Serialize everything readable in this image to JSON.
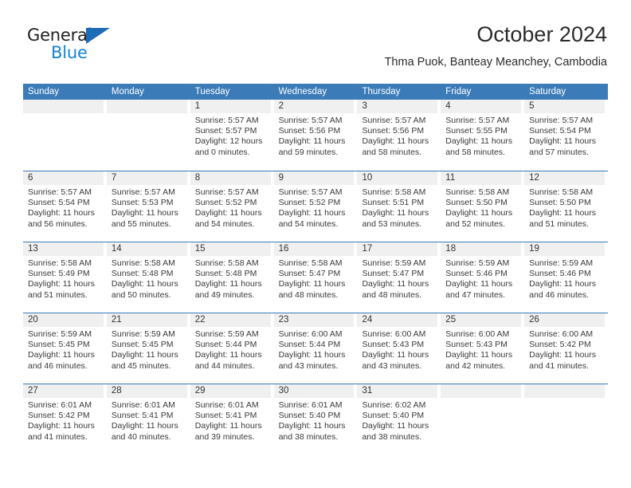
{
  "brand": {
    "name_top": "General",
    "name_bottom": "Blue",
    "triangle_color": "#1e6cb5",
    "blue_color": "#1583d4"
  },
  "header": {
    "month_title": "October 2024",
    "location": "Thma Puok, Banteay Meanchey, Cambodia",
    "header_bg": "#3b7cb8",
    "daynum_bg": "#f0f0f0"
  },
  "weekdays": [
    "Sunday",
    "Monday",
    "Tuesday",
    "Wednesday",
    "Thursday",
    "Friday",
    "Saturday"
  ],
  "weeks": [
    [
      {
        "day": ""
      },
      {
        "day": ""
      },
      {
        "day": "1",
        "sunrise": "Sunrise: 5:57 AM",
        "sunset": "Sunset: 5:57 PM",
        "daylight1": "Daylight: 12 hours",
        "daylight2": "and 0 minutes."
      },
      {
        "day": "2",
        "sunrise": "Sunrise: 5:57 AM",
        "sunset": "Sunset: 5:56 PM",
        "daylight1": "Daylight: 11 hours",
        "daylight2": "and 59 minutes."
      },
      {
        "day": "3",
        "sunrise": "Sunrise: 5:57 AM",
        "sunset": "Sunset: 5:56 PM",
        "daylight1": "Daylight: 11 hours",
        "daylight2": "and 58 minutes."
      },
      {
        "day": "4",
        "sunrise": "Sunrise: 5:57 AM",
        "sunset": "Sunset: 5:55 PM",
        "daylight1": "Daylight: 11 hours",
        "daylight2": "and 58 minutes."
      },
      {
        "day": "5",
        "sunrise": "Sunrise: 5:57 AM",
        "sunset": "Sunset: 5:54 PM",
        "daylight1": "Daylight: 11 hours",
        "daylight2": "and 57 minutes."
      }
    ],
    [
      {
        "day": "6",
        "sunrise": "Sunrise: 5:57 AM",
        "sunset": "Sunset: 5:54 PM",
        "daylight1": "Daylight: 11 hours",
        "daylight2": "and 56 minutes."
      },
      {
        "day": "7",
        "sunrise": "Sunrise: 5:57 AM",
        "sunset": "Sunset: 5:53 PM",
        "daylight1": "Daylight: 11 hours",
        "daylight2": "and 55 minutes."
      },
      {
        "day": "8",
        "sunrise": "Sunrise: 5:57 AM",
        "sunset": "Sunset: 5:52 PM",
        "daylight1": "Daylight: 11 hours",
        "daylight2": "and 54 minutes."
      },
      {
        "day": "9",
        "sunrise": "Sunrise: 5:57 AM",
        "sunset": "Sunset: 5:52 PM",
        "daylight1": "Daylight: 11 hours",
        "daylight2": "and 54 minutes."
      },
      {
        "day": "10",
        "sunrise": "Sunrise: 5:58 AM",
        "sunset": "Sunset: 5:51 PM",
        "daylight1": "Daylight: 11 hours",
        "daylight2": "and 53 minutes."
      },
      {
        "day": "11",
        "sunrise": "Sunrise: 5:58 AM",
        "sunset": "Sunset: 5:50 PM",
        "daylight1": "Daylight: 11 hours",
        "daylight2": "and 52 minutes."
      },
      {
        "day": "12",
        "sunrise": "Sunrise: 5:58 AM",
        "sunset": "Sunset: 5:50 PM",
        "daylight1": "Daylight: 11 hours",
        "daylight2": "and 51 minutes."
      }
    ],
    [
      {
        "day": "13",
        "sunrise": "Sunrise: 5:58 AM",
        "sunset": "Sunset: 5:49 PM",
        "daylight1": "Daylight: 11 hours",
        "daylight2": "and 51 minutes."
      },
      {
        "day": "14",
        "sunrise": "Sunrise: 5:58 AM",
        "sunset": "Sunset: 5:48 PM",
        "daylight1": "Daylight: 11 hours",
        "daylight2": "and 50 minutes."
      },
      {
        "day": "15",
        "sunrise": "Sunrise: 5:58 AM",
        "sunset": "Sunset: 5:48 PM",
        "daylight1": "Daylight: 11 hours",
        "daylight2": "and 49 minutes."
      },
      {
        "day": "16",
        "sunrise": "Sunrise: 5:58 AM",
        "sunset": "Sunset: 5:47 PM",
        "daylight1": "Daylight: 11 hours",
        "daylight2": "and 48 minutes."
      },
      {
        "day": "17",
        "sunrise": "Sunrise: 5:59 AM",
        "sunset": "Sunset: 5:47 PM",
        "daylight1": "Daylight: 11 hours",
        "daylight2": "and 48 minutes."
      },
      {
        "day": "18",
        "sunrise": "Sunrise: 5:59 AM",
        "sunset": "Sunset: 5:46 PM",
        "daylight1": "Daylight: 11 hours",
        "daylight2": "and 47 minutes."
      },
      {
        "day": "19",
        "sunrise": "Sunrise: 5:59 AM",
        "sunset": "Sunset: 5:46 PM",
        "daylight1": "Daylight: 11 hours",
        "daylight2": "and 46 minutes."
      }
    ],
    [
      {
        "day": "20",
        "sunrise": "Sunrise: 5:59 AM",
        "sunset": "Sunset: 5:45 PM",
        "daylight1": "Daylight: 11 hours",
        "daylight2": "and 46 minutes."
      },
      {
        "day": "21",
        "sunrise": "Sunrise: 5:59 AM",
        "sunset": "Sunset: 5:45 PM",
        "daylight1": "Daylight: 11 hours",
        "daylight2": "and 45 minutes."
      },
      {
        "day": "22",
        "sunrise": "Sunrise: 5:59 AM",
        "sunset": "Sunset: 5:44 PM",
        "daylight1": "Daylight: 11 hours",
        "daylight2": "and 44 minutes."
      },
      {
        "day": "23",
        "sunrise": "Sunrise: 6:00 AM",
        "sunset": "Sunset: 5:44 PM",
        "daylight1": "Daylight: 11 hours",
        "daylight2": "and 43 minutes."
      },
      {
        "day": "24",
        "sunrise": "Sunrise: 6:00 AM",
        "sunset": "Sunset: 5:43 PM",
        "daylight1": "Daylight: 11 hours",
        "daylight2": "and 43 minutes."
      },
      {
        "day": "25",
        "sunrise": "Sunrise: 6:00 AM",
        "sunset": "Sunset: 5:43 PM",
        "daylight1": "Daylight: 11 hours",
        "daylight2": "and 42 minutes."
      },
      {
        "day": "26",
        "sunrise": "Sunrise: 6:00 AM",
        "sunset": "Sunset: 5:42 PM",
        "daylight1": "Daylight: 11 hours",
        "daylight2": "and 41 minutes."
      }
    ],
    [
      {
        "day": "27",
        "sunrise": "Sunrise: 6:01 AM",
        "sunset": "Sunset: 5:42 PM",
        "daylight1": "Daylight: 11 hours",
        "daylight2": "and 41 minutes."
      },
      {
        "day": "28",
        "sunrise": "Sunrise: 6:01 AM",
        "sunset": "Sunset: 5:41 PM",
        "daylight1": "Daylight: 11 hours",
        "daylight2": "and 40 minutes."
      },
      {
        "day": "29",
        "sunrise": "Sunrise: 6:01 AM",
        "sunset": "Sunset: 5:41 PM",
        "daylight1": "Daylight: 11 hours",
        "daylight2": "and 39 minutes."
      },
      {
        "day": "30",
        "sunrise": "Sunrise: 6:01 AM",
        "sunset": "Sunset: 5:40 PM",
        "daylight1": "Daylight: 11 hours",
        "daylight2": "and 38 minutes."
      },
      {
        "day": "31",
        "sunrise": "Sunrise: 6:02 AM",
        "sunset": "Sunset: 5:40 PM",
        "daylight1": "Daylight: 11 hours",
        "daylight2": "and 38 minutes."
      },
      {
        "day": ""
      },
      {
        "day": ""
      }
    ]
  ]
}
